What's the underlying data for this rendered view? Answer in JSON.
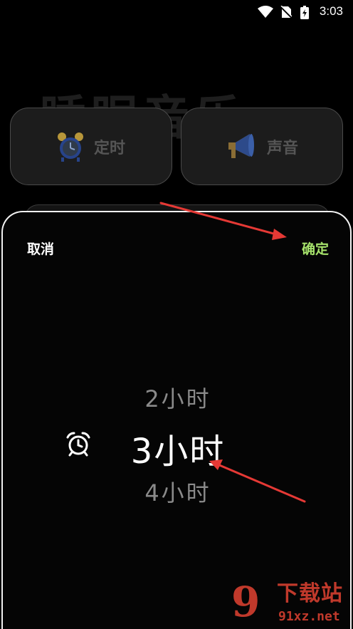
{
  "status_bar": {
    "time": "3:03"
  },
  "background": {
    "title": "睡眠音乐",
    "cards": [
      {
        "label": "定时",
        "icon": "alarm-clock-icon"
      },
      {
        "label": "声音",
        "icon": "megaphone-icon"
      }
    ]
  },
  "sheet": {
    "cancel_label": "取消",
    "confirm_label": "确定",
    "picker": {
      "prev": "2小时",
      "selected": "3小时",
      "next": "4小时",
      "icon": "alarm-clock-icon"
    }
  },
  "colors": {
    "confirm": "#a6e26b",
    "arrow": "#e53935",
    "watermark": "#c0392b"
  },
  "watermark": {
    "logo": "9",
    "text": "下载站",
    "url": "91xz.net"
  }
}
